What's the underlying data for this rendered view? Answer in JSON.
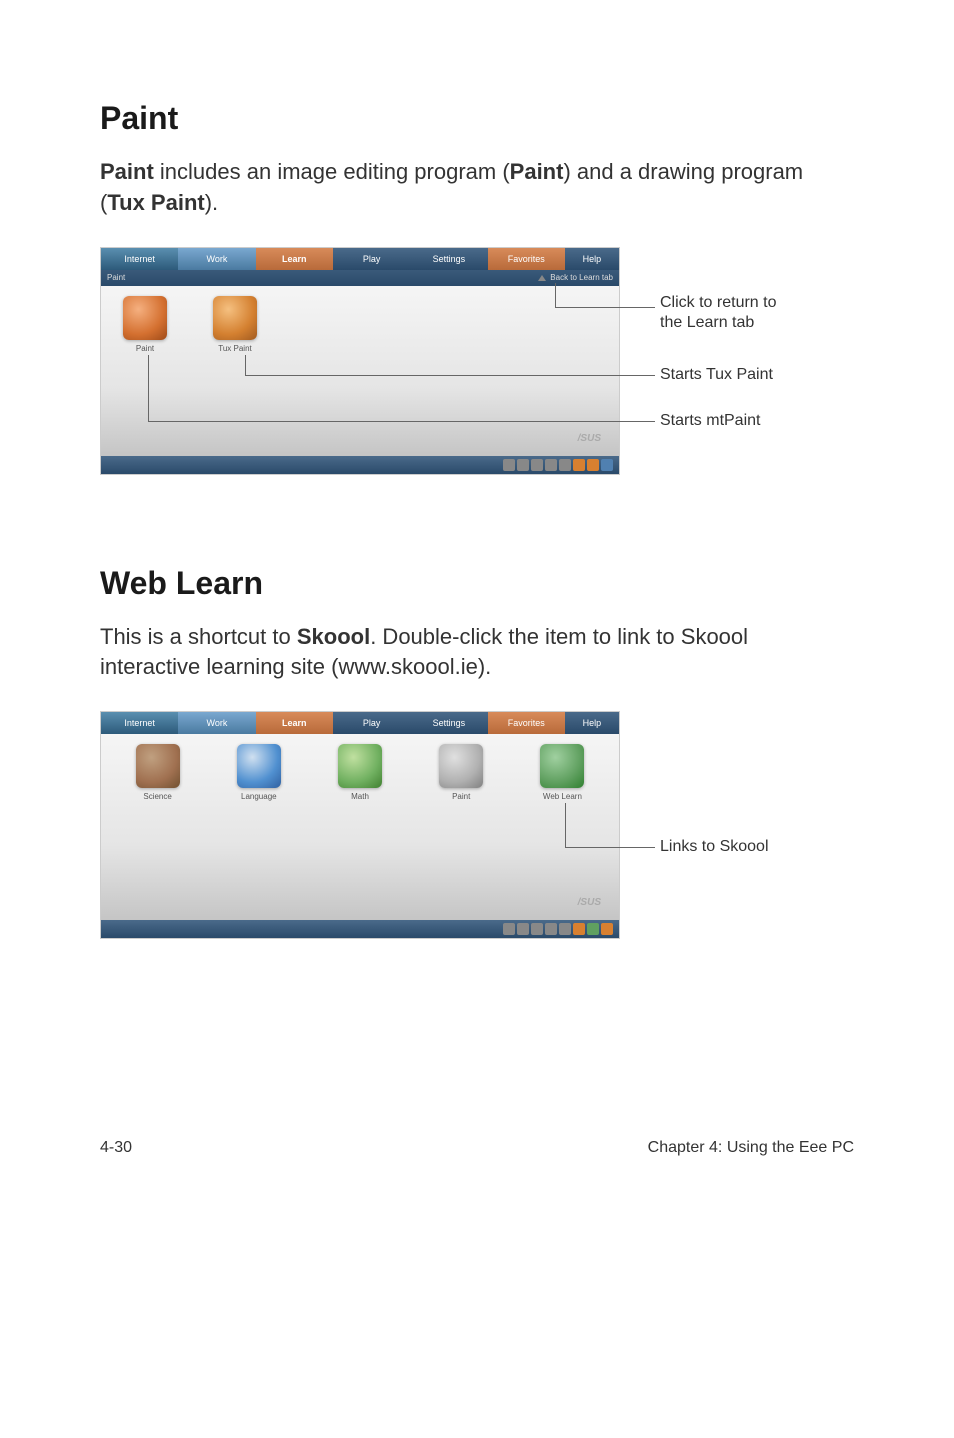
{
  "section1": {
    "title": "Paint",
    "intro_prefix": "Paint",
    "intro_mid1": " includes an image editing program (",
    "intro_bold1": "Paint",
    "intro_mid2": ") and a drawing program (",
    "intro_bold2": "Tux Paint",
    "intro_suffix": ")."
  },
  "nav": {
    "internet": "Internet",
    "work": "Work",
    "learn": "Learn",
    "play": "Play",
    "settings": "Settings",
    "favorites": "Favorites",
    "help": "Help"
  },
  "shot1": {
    "subbar_left": "Paint",
    "back_link": "Back to Learn tab",
    "icon1": "Paint",
    "icon2": "Tux Paint",
    "asus": "/SUS"
  },
  "callouts1": {
    "c1_l1": "Click to return to",
    "c1_l2": "the Learn tab",
    "c2": "Starts Tux Paint",
    "c3": "Starts mtPaint"
  },
  "section2": {
    "title": "Web Learn",
    "intro_pre": "This is a shortcut to ",
    "intro_bold": "Skoool",
    "intro_post": ". Double-click the item to link to Skoool interactive learning site (www.skoool.ie)."
  },
  "shot2": {
    "icon1": "Science",
    "icon2": "Language",
    "icon3": "Math",
    "icon4": "Paint",
    "icon5": "Web Learn",
    "asus": "/SUS"
  },
  "callouts2": {
    "c1": "Links to Skoool"
  },
  "footer": {
    "left": "4-30",
    "right": "Chapter 4: Using the Eee PC"
  }
}
